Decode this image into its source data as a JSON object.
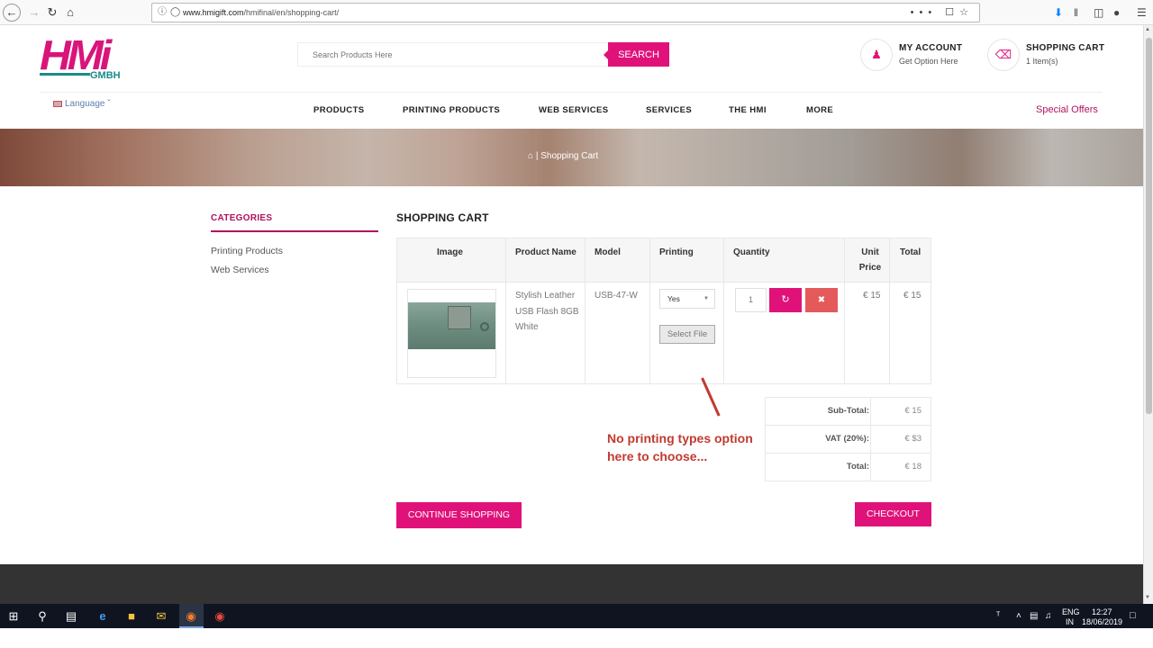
{
  "browser": {
    "url_host": "www.hmigift.com",
    "url_path": "/hmifinal/en/shopping-cart/",
    "more_icon": "•••"
  },
  "site": {
    "logo_text": "HMi",
    "logo_sub": "GMBH",
    "brand_color": "#e0127a",
    "accent_color": "#b0125e"
  },
  "search": {
    "placeholder": "Search Products Here",
    "button": "SEARCH"
  },
  "account": {
    "title": "MY ACCOUNT",
    "subtitle": "Get Option Here"
  },
  "cart_header": {
    "title": "SHOPPING CART",
    "subtitle": "1 Item(s)"
  },
  "language": "Language",
  "nav": [
    "PRODUCTS",
    "PRINTING PRODUCTS",
    "WEB SERVICES",
    "SERVICES",
    "THE HMI",
    "MORE"
  ],
  "special_offers": "Special Offers",
  "breadcrumb": {
    "separator": "|",
    "current": "Shopping Cart"
  },
  "sidebar": {
    "title": "CATEGORIES",
    "items": [
      "Printing Products",
      "Web Services"
    ]
  },
  "page_title": "SHOPPING CART",
  "table": {
    "headers": [
      "Image",
      "Product Name",
      "Model",
      "Printing",
      "Quantity",
      "Unit Price",
      "Total"
    ],
    "row": {
      "product_name": "Stylish Leather USB Flash 8GB White",
      "model": "USB-47-W",
      "printing_selected": "Yes",
      "select_file": "Select File",
      "quantity": "1",
      "unit_price": "€ 15",
      "total": "€ 15"
    }
  },
  "totals": [
    {
      "label": "Sub-Total:",
      "value": "€ 15"
    },
    {
      "label": "VAT (20%):",
      "value": "€ $3"
    },
    {
      "label": "Total:",
      "value": "€ 18"
    }
  ],
  "annotation": "No printing types option\nhere to choose...",
  "annotation_color": "#c23a2e",
  "buttons": {
    "continue": "CONTINUE SHOPPING",
    "checkout": "CHECKOUT"
  },
  "taskbar": {
    "lang_top": "ENG",
    "lang_bottom": "IN",
    "time": "12:27",
    "date": "18/06/2019"
  }
}
